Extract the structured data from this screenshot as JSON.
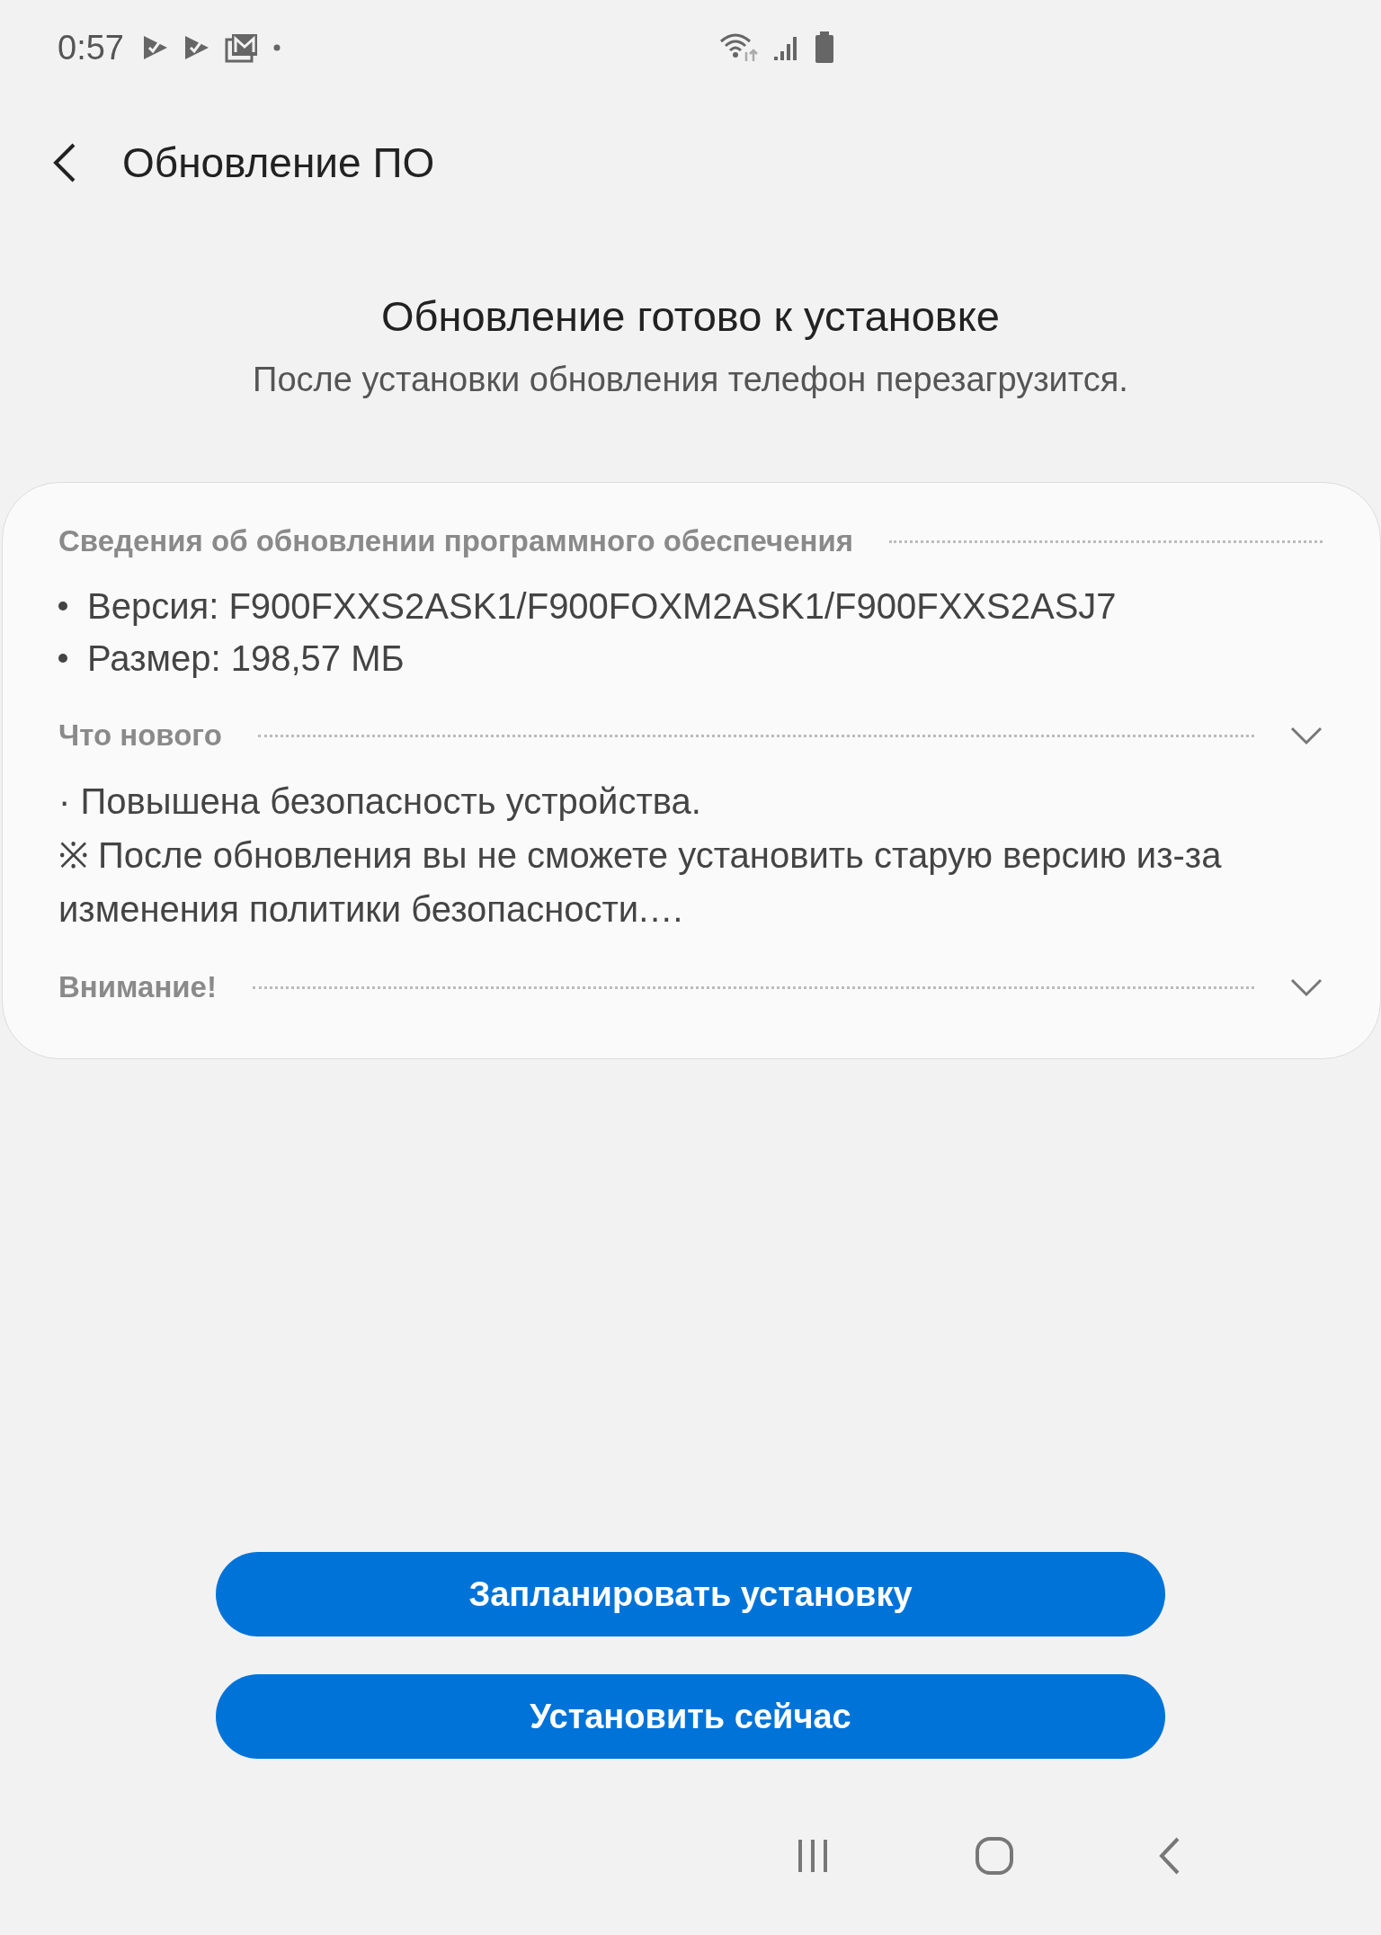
{
  "status_bar": {
    "time": "0:57"
  },
  "header": {
    "title": "Обновление ПО"
  },
  "intro": {
    "heading": "Обновление готово к установке",
    "subtitle": "После установки обновления телефон перезагрузится."
  },
  "card": {
    "sections": [
      {
        "kind": "bullets",
        "title": "Сведения об обновлении программного обеспечения",
        "items": [
          "Версия: F900FXXS2ASK1/F900FOXM2ASK1/F900FXXS2ASJ7",
          "Размер: 198,57 МБ"
        ]
      },
      {
        "kind": "expandable",
        "title": "Что нового",
        "lines": [
          "· Повышена безопасность устройства.",
          "※ После обновления вы не сможете установить старую версию из-за изменения политики безопасности.…"
        ]
      },
      {
        "kind": "expandable",
        "title": "Внимание!"
      }
    ]
  },
  "buttons": [
    "Запланировать установку",
    "Установить сейчас"
  ]
}
